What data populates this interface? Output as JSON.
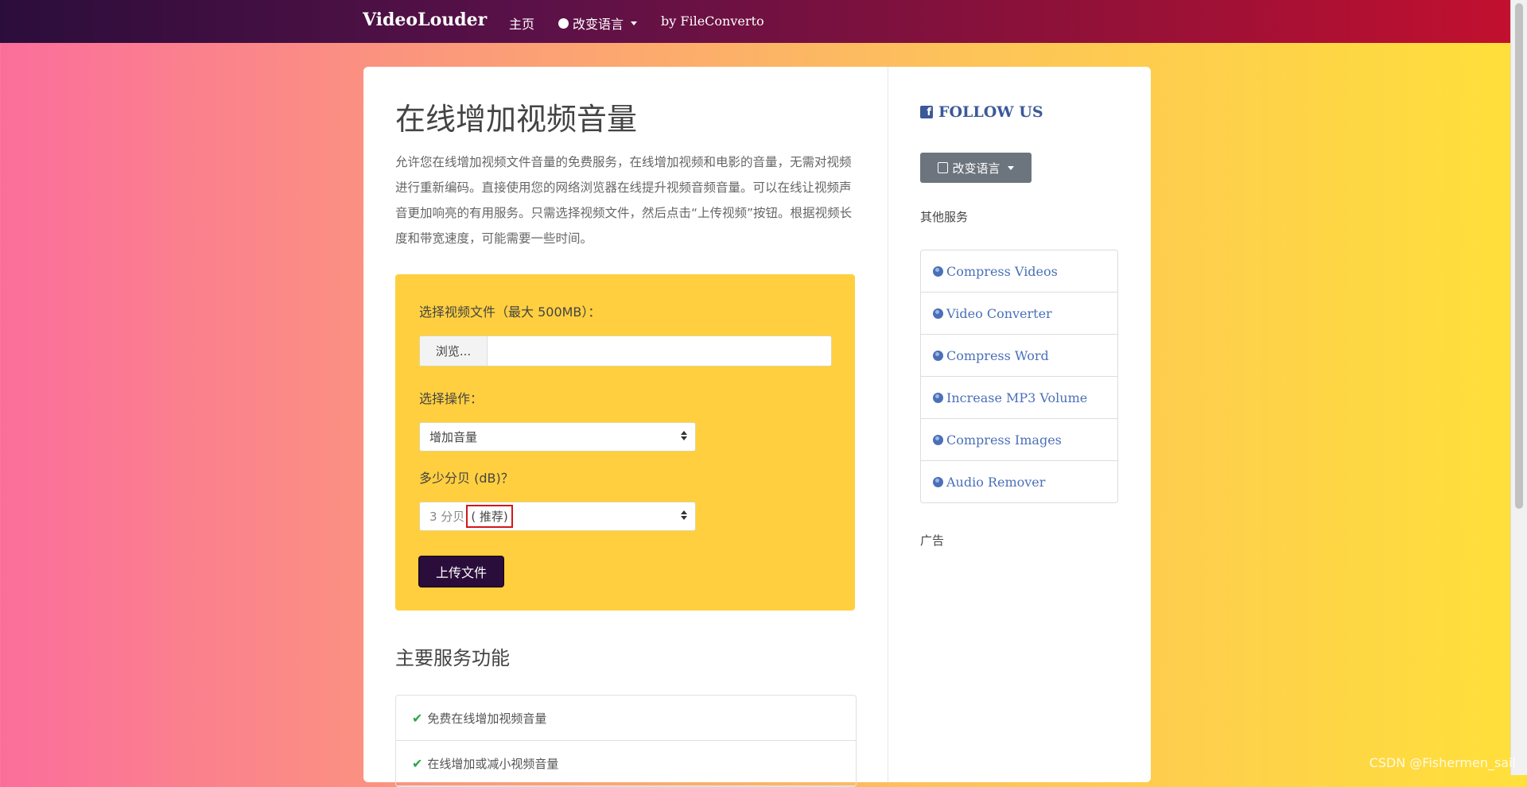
{
  "nav": {
    "brand": "VideoLouder",
    "home": "主页",
    "language": "改变语言",
    "by": "by FileConverto"
  },
  "main": {
    "title": "在线增加视频音量",
    "description": "允许您在线增加视频文件音量的免费服务，在线增加视频和电影的音量，无需对视频进行重新编码。直接使用您的网络浏览器在线提升视频音频音量。可以在线让视频声音更加响亮的有用服务。只需选择视频文件，然后点击“上传视频”按钮。根据视频长度和带宽速度，可能需要一些时间。",
    "form": {
      "file_label": "选择视频文件（最大 500MB）：",
      "browse_label": "浏览...",
      "file_value": "",
      "operation_label": "选择操作：",
      "operation_value": "增加音量",
      "db_label": "多少分贝 (dB)？",
      "db_value": "3 分贝",
      "db_recommended": "( 推荐)",
      "upload_label": "上传文件"
    },
    "features_title": "主要服务功能",
    "features": [
      "免费在线增加视频音量",
      "在线增加或减小视频音量"
    ]
  },
  "sidebar": {
    "follow": "FOLLOW US",
    "lang_button": "改变语言",
    "other_services_label": "其他服务",
    "services": [
      "Compress Videos",
      "Video Converter",
      "Compress Word",
      "Increase MP3 Volume",
      "Compress Images",
      "Audio Remover"
    ],
    "ads_label": "广告"
  },
  "watermark": "CSDN @Fishermen_sail",
  "colors": {
    "accent": "#ffcf3f",
    "nav_start": "#2b0d3b",
    "nav_end": "#c2102f",
    "link": "#4a70b8",
    "facebook": "#3b5998"
  }
}
